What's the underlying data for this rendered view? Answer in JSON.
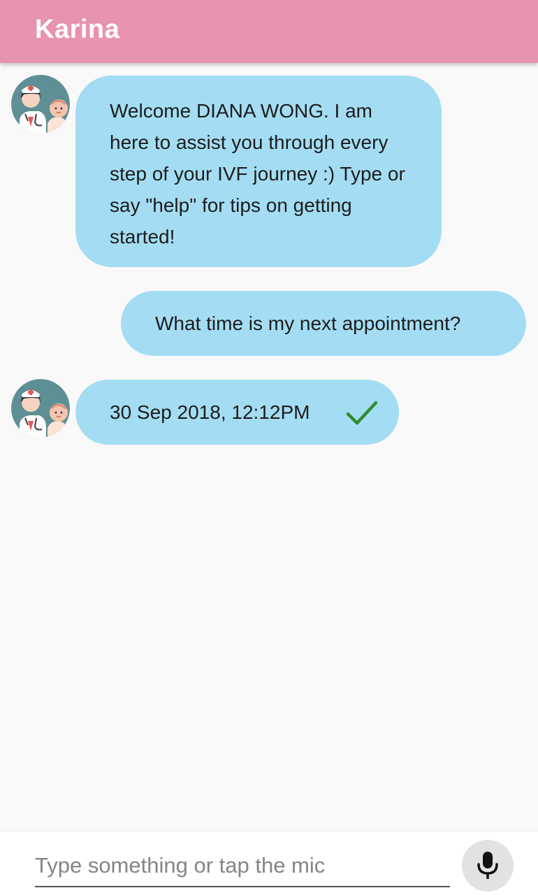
{
  "app_bar": {
    "title": "Karina"
  },
  "messages": [
    {
      "sender": "bot",
      "avatar_icon": "nurse-baby-avatar",
      "text": "Welcome DIANA WONG. I am here to assist you through every step of your IVF journey :) Type or say \"help\" for tips on getting started!"
    },
    {
      "sender": "user",
      "text": "What time is my next appointment?"
    },
    {
      "sender": "bot",
      "avatar_icon": "nurse-baby-avatar",
      "text": "30 Sep 2018, 12:12PM",
      "status_icon": "check-icon"
    }
  ],
  "composer": {
    "placeholder": "Type something or tap the mic",
    "value": "",
    "mic_icon": "microphone-icon"
  },
  "colors": {
    "app_bar": "#e893b1",
    "bubble": "#a4ddf3",
    "check": "#2e8b2e",
    "background": "#faf9f9"
  }
}
